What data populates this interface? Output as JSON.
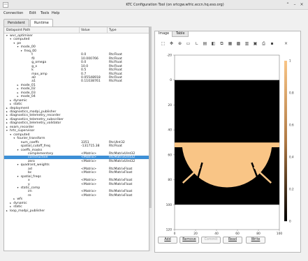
{
  "window": {
    "title": "KTC Configuration Tool (on srtcgw.wfric.eccn.hq.eso.org)"
  },
  "menu": [
    "Connection",
    "Edit",
    "Tools",
    "Help"
  ],
  "main_tabs": [
    "Persistent",
    "Runtime"
  ],
  "tree": {
    "columns": [
      "Datapoint Path",
      "Value",
      "Type"
    ],
    "rows": [
      {
        "name": "wvc_optimiser",
        "value": "",
        "type": "",
        "level": 0,
        "arrow": "▾"
      },
      {
        "name": "computed",
        "value": "",
        "type": "",
        "level": 1,
        "arrow": "▾"
      },
      {
        "name": "pe",
        "value": "",
        "type": "",
        "level": 2,
        "arrow": "▾"
      },
      {
        "name": "mode_00",
        "value": "",
        "type": "",
        "level": 3,
        "arrow": "▾"
      },
      {
        "name": "freq_00",
        "value": "",
        "type": "",
        "level": 4,
        "arrow": "▾"
      },
      {
        "name": "t",
        "value": "0.0",
        "type": "RtcFloat",
        "level": 6,
        "arrow": ""
      },
      {
        "name": "f0",
        "value": "10.000766",
        "type": "RtcFloat",
        "level": 6,
        "arrow": ""
      },
      {
        "name": "g_omega",
        "value": "0.0",
        "type": "RtcFloat",
        "level": 6,
        "arrow": ""
      },
      {
        "name": "g_x",
        "value": "10.0",
        "type": "RtcFloat",
        "level": 6,
        "arrow": ""
      },
      {
        "name": "k",
        "value": "0.5",
        "type": "RtcFloat",
        "level": 6,
        "arrow": ""
      },
      {
        "name": "max_amp",
        "value": "0.7",
        "type": "RtcFloat",
        "level": 6,
        "arrow": ""
      },
      {
        "name": "a0",
        "value": "0.05548918",
        "type": "RtcFloat",
        "level": 6,
        "arrow": ""
      },
      {
        "name": "a1",
        "value": "0.11038761",
        "type": "RtcFloat",
        "level": 6,
        "arrow": ""
      },
      {
        "name": "mode_01",
        "value": "",
        "type": "",
        "level": 3,
        "arrow": "▸"
      },
      {
        "name": "mode_02",
        "value": "",
        "type": "",
        "level": 3,
        "arrow": "▸"
      },
      {
        "name": "mode_03",
        "value": "",
        "type": "",
        "level": 3,
        "arrow": "▸"
      },
      {
        "name": "mode_04",
        "value": "",
        "type": "",
        "level": 3,
        "arrow": "▸"
      },
      {
        "name": "dynamic",
        "value": "",
        "type": "",
        "level": 1,
        "arrow": "▸"
      },
      {
        "name": "static",
        "value": "",
        "type": "",
        "level": 1,
        "arrow": "▸"
      },
      {
        "name": "deployment",
        "value": "",
        "type": "",
        "level": 0,
        "arrow": "▸"
      },
      {
        "name": "diagnostics_modpi_publisher",
        "value": "",
        "type": "",
        "level": 0,
        "arrow": "▸"
      },
      {
        "name": "diagnostics_telemetry_recorder",
        "value": "",
        "type": "",
        "level": 0,
        "arrow": "▸"
      },
      {
        "name": "diagnostics_telemetry_subscriber",
        "value": "",
        "type": "",
        "level": 0,
        "arrow": "▸"
      },
      {
        "name": "diagnostics_telemetry_validator",
        "value": "",
        "type": "",
        "level": 0,
        "arrow": "▸"
      },
      {
        "name": "exam_recorder",
        "value": "",
        "type": "",
        "level": 0,
        "arrow": "▸"
      },
      {
        "name": "hrtc_supervisor",
        "value": "",
        "type": "",
        "level": 0,
        "arrow": "▾"
      },
      {
        "name": "computed",
        "value": "",
        "type": "",
        "level": 1,
        "arrow": "▾"
      },
      {
        "name": "fourier_transform",
        "value": "",
        "type": "",
        "level": 2,
        "arrow": "▾"
      },
      {
        "name": "num_coeffs",
        "value": "3351",
        "type": "RtcUInt32",
        "level": 3,
        "arrow": ""
      },
      {
        "name": "spatial_cutoff_freq",
        "value": "-131715.38",
        "type": "RtcFloat",
        "level": 3,
        "arrow": ""
      },
      {
        "name": "coeffs_masks",
        "value": "",
        "type": "",
        "level": 3,
        "arrow": "▾"
      },
      {
        "name": "complementary",
        "value": "<Matrix>",
        "type": "RtcMatrixUInt32",
        "level": 5,
        "arrow": ""
      },
      {
        "name": "constructive",
        "value": "<Matrix>",
        "type": "RtcMatrixUInt32",
        "level": 5,
        "arrow": "",
        "selected": true
      },
      {
        "name": "zero",
        "value": "<Matrix>",
        "type": "RtcMatrixUInt32",
        "level": 5,
        "arrow": ""
      },
      {
        "name": "quadrant_weights",
        "value": "",
        "type": "",
        "level": 3,
        "arrow": "▾"
      },
      {
        "name": "ad",
        "value": "<Matrix>",
        "type": "RtcMatrixFloat",
        "level": 5,
        "arrow": ""
      },
      {
        "name": "bc",
        "value": "<Matrix>",
        "type": "RtcMatrixFloat",
        "level": 5,
        "arrow": ""
      },
      {
        "name": "spatial_freqs",
        "value": "",
        "type": "",
        "level": 3,
        "arrow": "▾"
      },
      {
        "name": "x",
        "value": "<Matrix>",
        "type": "RtcMatrixFloat",
        "level": 5,
        "arrow": ""
      },
      {
        "name": "y",
        "value": "<Matrix>",
        "type": "RtcMatrixFloat",
        "level": 5,
        "arrow": ""
      },
      {
        "name": "static_comp",
        "value": "",
        "type": "",
        "level": 3,
        "arrow": "▾"
      },
      {
        "name": "im",
        "value": "<Matrix>",
        "type": "RtcMatrixFloat",
        "level": 5,
        "arrow": ""
      },
      {
        "name": "re",
        "value": "<Matrix>",
        "type": "RtcMatrixFloat",
        "level": 5,
        "arrow": ""
      },
      {
        "name": "wfs",
        "value": "",
        "type": "",
        "level": 2,
        "arrow": "▸"
      },
      {
        "name": "dynamic",
        "value": "",
        "type": "",
        "level": 1,
        "arrow": "▸"
      },
      {
        "name": "static",
        "value": "",
        "type": "",
        "level": 1,
        "arrow": "▸"
      },
      {
        "name": "loop_modpi_publisher",
        "value": "",
        "type": "",
        "level": 0,
        "arrow": "▸"
      }
    ]
  },
  "viewer": {
    "tabs": [
      "Image",
      "Table"
    ],
    "toolbar_icons": [
      "pointer-icon",
      "pan-icon",
      "zoom-icon",
      "zoom-box-icon",
      "axes-icon",
      "colorbar-icon",
      "colormap-icon",
      "copy-icon",
      "save-icon",
      "grid-icon",
      "chart-icon",
      "settings-icon",
      "print-icon",
      "camera-icon",
      "close-icon"
    ],
    "colors": {
      "mask_on": "#f9c586",
      "mask_off": "#000000"
    }
  },
  "chart_data": {
    "type": "heatmap",
    "x_ticks": [
      "0",
      "20",
      "40",
      "60",
      "80",
      "100"
    ],
    "y_ticks": [
      "-20",
      "0",
      "20",
      "40",
      "60",
      "80",
      "100",
      "120"
    ],
    "colorbar_ticks": [
      "1",
      "0.8",
      "0.6",
      "0.4",
      "0.2",
      "0"
    ],
    "xlim": [
      0,
      100
    ],
    "ylim": [
      -20,
      120
    ],
    "matrix_extent": {
      "rows": 100,
      "cols": 100
    },
    "content": "binary mask (0/1): top half 0, lower half 1 inside a half-disc with a horizontal band"
  },
  "buttons": [
    {
      "label": "Add",
      "enabled": true
    },
    {
      "label": "Remove",
      "enabled": true
    },
    {
      "label": "Commit",
      "enabled": false
    },
    {
      "label": "Read",
      "enabled": true
    },
    {
      "label": "Write",
      "enabled": true
    }
  ]
}
